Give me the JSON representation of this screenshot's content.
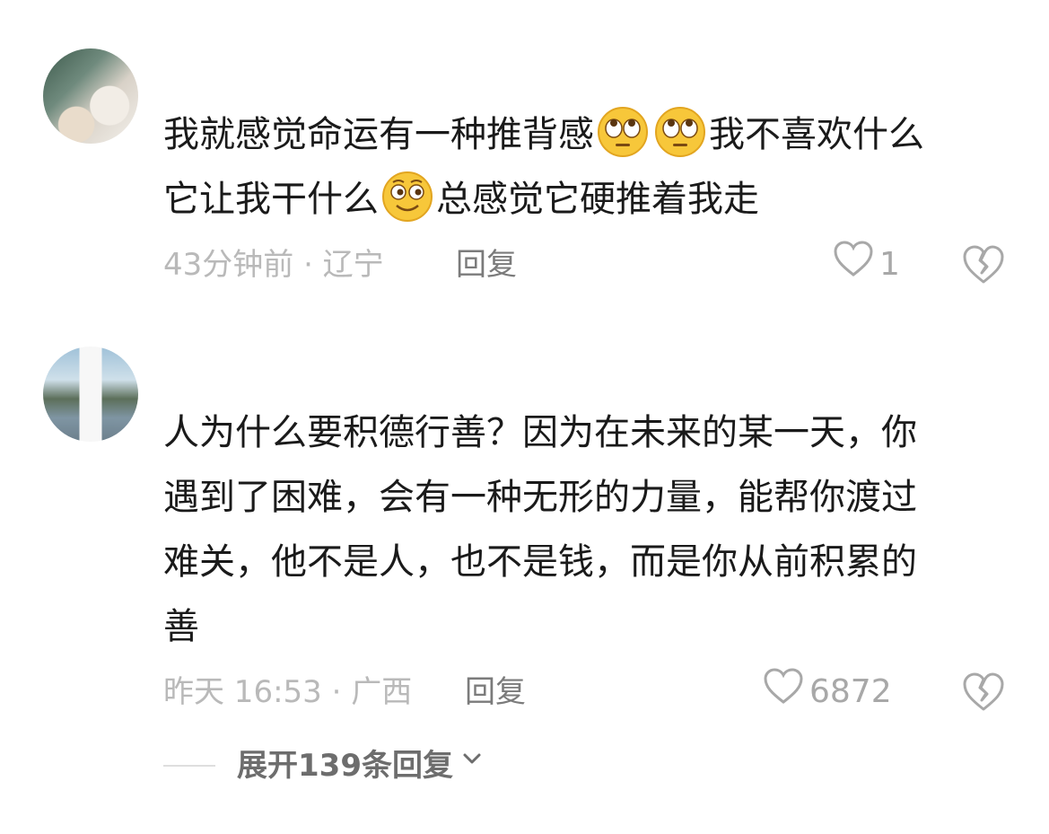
{
  "comments": [
    {
      "text_line1": "我就感觉命运有一种推背感",
      "text_line1_tail": "我不喜欢什么",
      "text_line2_head": "它让我干什么",
      "text_line2_tail": "总感觉它硬推着我走",
      "emojis": [
        "rolling-eyes-emoji",
        "rolling-eyes-emoji",
        "sly-smile-emoji"
      ],
      "meta": "43分钟前 · 辽宁",
      "reply_label": "回复",
      "likes": "1"
    },
    {
      "text_lines": [
        "人为什么要积德行善？因为在未来的某一天，你",
        "遇到了困难，会有一种无形的力量，能帮你渡过",
        "难关，他不是人，也不是钱，而是你从前积累的",
        "善"
      ],
      "meta": "昨天 16:53 · 广西",
      "reply_label": "回复",
      "likes": "6872"
    }
  ],
  "expand_replies_label": "展开139条回复",
  "icons": {
    "like": "heart-outline-icon",
    "dislike": "broken-heart-icon",
    "expand": "chevron-down-icon"
  }
}
